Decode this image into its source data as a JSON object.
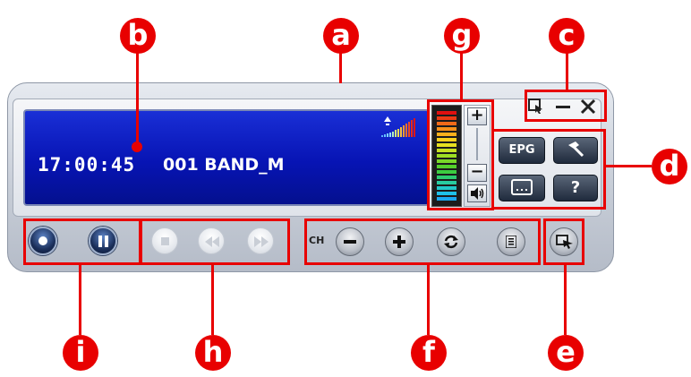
{
  "callouts": {
    "a": "a",
    "b": "b",
    "c": "c",
    "d": "d",
    "e": "e",
    "f": "f",
    "g": "g",
    "h": "h",
    "i": "i"
  },
  "display": {
    "time": "17:00:45",
    "channel": "001 BAND_M"
  },
  "volume": {
    "plus": "+",
    "minus": "−",
    "speaker_icon": "speaker-icon"
  },
  "window_buttons": [
    {
      "name": "pin-icon"
    },
    {
      "name": "minimize-icon"
    },
    {
      "name": "close-icon"
    }
  ],
  "feature_buttons": {
    "epg": "EPG",
    "help": "?",
    "settings_icon": "hammer-icon",
    "subtitle_icon": "subtitle-icon"
  },
  "channel": {
    "label": "CH"
  },
  "colors": {
    "callout": "#e80000",
    "screen": "#0a1ac0",
    "text": "#ffffff"
  }
}
